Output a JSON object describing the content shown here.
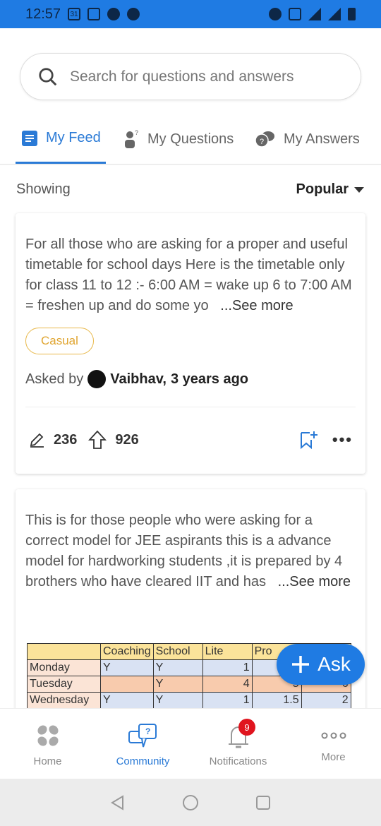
{
  "status_bar": {
    "time": "12:57",
    "calendar_day": "31"
  },
  "search": {
    "placeholder": "Search for questions and answers"
  },
  "tabs": [
    {
      "label": "My Feed",
      "active": true
    },
    {
      "label": "My Questions"
    },
    {
      "label": "My Answers"
    }
  ],
  "filter": {
    "showing_label": "Showing",
    "sort_value": "Popular"
  },
  "posts": [
    {
      "text": "For all those who are asking for a proper and useful timetable for school days Here is the timetable only for class 11 to 12 :- 6:00 AM = wake up 6 to 7:00 AM = freshen up and do some yo",
      "see_more": "...See more",
      "tag": "Casual",
      "asked_by_label": "Asked by",
      "author": "Vaibhav,",
      "age": "3 years ago",
      "answers": "236",
      "upvotes": "926"
    },
    {
      "text": "This is for those people who were asking for a correct model for JEE aspirants this is a advance model for hardworking students ,it is prepared by 4 brothers who have cleared IIT and has",
      "see_more": "...See more",
      "image_table": {
        "headers": [
          "",
          "Coaching",
          "School",
          "Lite",
          "Pro",
          ""
        ],
        "rows": [
          [
            "Monday",
            "Y",
            "Y",
            "1",
            "",
            ""
          ],
          [
            "Tuesday",
            "",
            "Y",
            "4",
            "5",
            "6"
          ],
          [
            "Wednesday",
            "Y",
            "Y",
            "1",
            "1.5",
            "2"
          ]
        ]
      }
    }
  ],
  "ask_button": {
    "label": "Ask"
  },
  "bottom_nav": [
    {
      "label": "Home"
    },
    {
      "label": "Community",
      "active": true
    },
    {
      "label": "Notifications",
      "badge": "9"
    },
    {
      "label": "More"
    }
  ],
  "colors": {
    "accent": "#2a7ad6",
    "status_bar": "#1f7be3",
    "badge": "#e0141e",
    "chip": "#e0a530"
  }
}
